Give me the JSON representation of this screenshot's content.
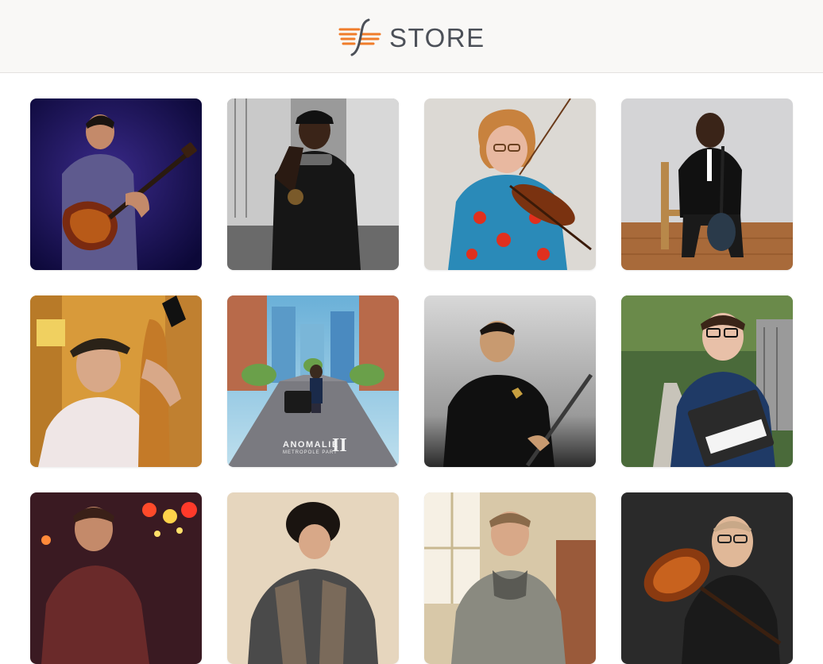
{
  "header": {
    "brand_text": "STORE",
    "logo_icon": "soundslice-logo-icon"
  },
  "products": [
    {
      "image": "guitarist-on-stage-purple-light"
    },
    {
      "image": "guitarist-black-hoodie-truck"
    },
    {
      "image": "violinist-red-floral-shirt"
    },
    {
      "image": "guitarist-leather-jacket-chair"
    },
    {
      "image": "double-bassist-flat-cap"
    },
    {
      "image": "album-cover-city-street",
      "album_title": "ANOMALIE",
      "album_subtitle": "METROPOLE PART",
      "album_numeral": "II"
    },
    {
      "image": "flutist-black-polo"
    },
    {
      "image": "keyboardist-synthesizer-alley"
    },
    {
      "image": "guitarist-stage-lights"
    },
    {
      "image": "guitarist-curly-hair"
    },
    {
      "image": "guitarist-window-scarf"
    },
    {
      "image": "mandolinist-suit"
    }
  ],
  "colors": {
    "header_bg": "#f9f8f6",
    "logo_orange": "#f07c2a",
    "logo_dark": "#4c5058"
  }
}
